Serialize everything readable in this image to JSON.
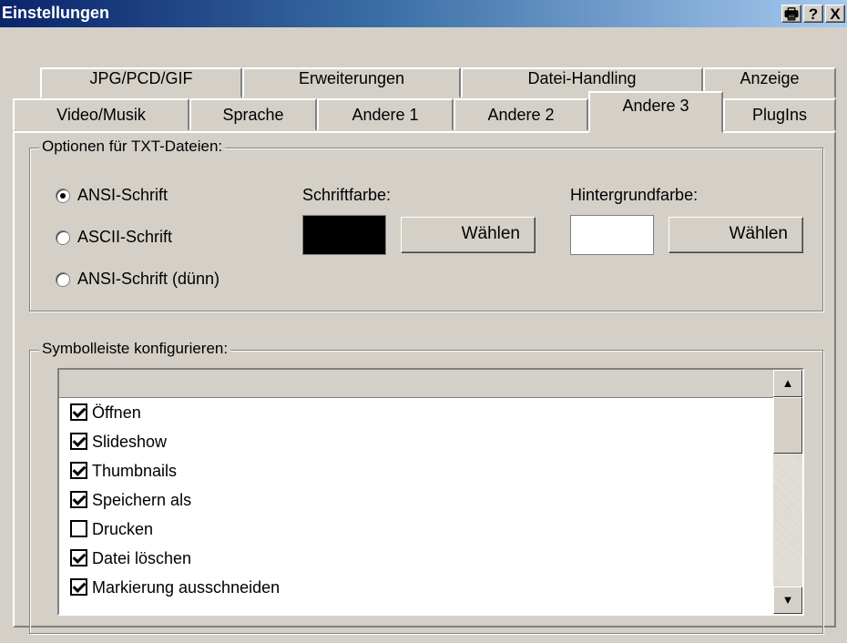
{
  "window": {
    "title": "Einstellungen"
  },
  "titlebar_buttons": {
    "print": "🖶",
    "help": "?",
    "close": "X"
  },
  "tabs_row1": [
    "JPG/PCD/GIF",
    "Erweiterungen",
    "Datei-Handling",
    "Anzeige"
  ],
  "tabs_row2": [
    "Video/Musik",
    "Sprache",
    "Andere 1",
    "Andere 2",
    "Andere 3",
    "PlugIns"
  ],
  "active_tab": "Andere 3",
  "txt_group": {
    "label": "Optionen für TXT-Dateien:",
    "radios": [
      {
        "label": "ANSI-Schrift",
        "selected": true
      },
      {
        "label": "ASCII-Schrift",
        "selected": false
      },
      {
        "label": "ANSI-Schrift (dünn)",
        "selected": false
      }
    ],
    "font_color_label": "Schriftfarbe:",
    "font_color": "#000000",
    "font_color_button": "Wählen",
    "bg_color_label": "Hintergrundfarbe:",
    "bg_color": "#ffffff",
    "bg_color_button": "Wählen"
  },
  "toolbar_group": {
    "label": "Symbolleiste konfigurieren:",
    "items": [
      {
        "label": "Öffnen",
        "checked": true
      },
      {
        "label": "Slideshow",
        "checked": true
      },
      {
        "label": "Thumbnails",
        "checked": true
      },
      {
        "label": "Speichern als",
        "checked": true
      },
      {
        "label": "Drucken",
        "checked": false
      },
      {
        "label": "Datei löschen",
        "checked": true
      },
      {
        "label": "Markierung ausschneiden",
        "checked": true
      }
    ]
  }
}
